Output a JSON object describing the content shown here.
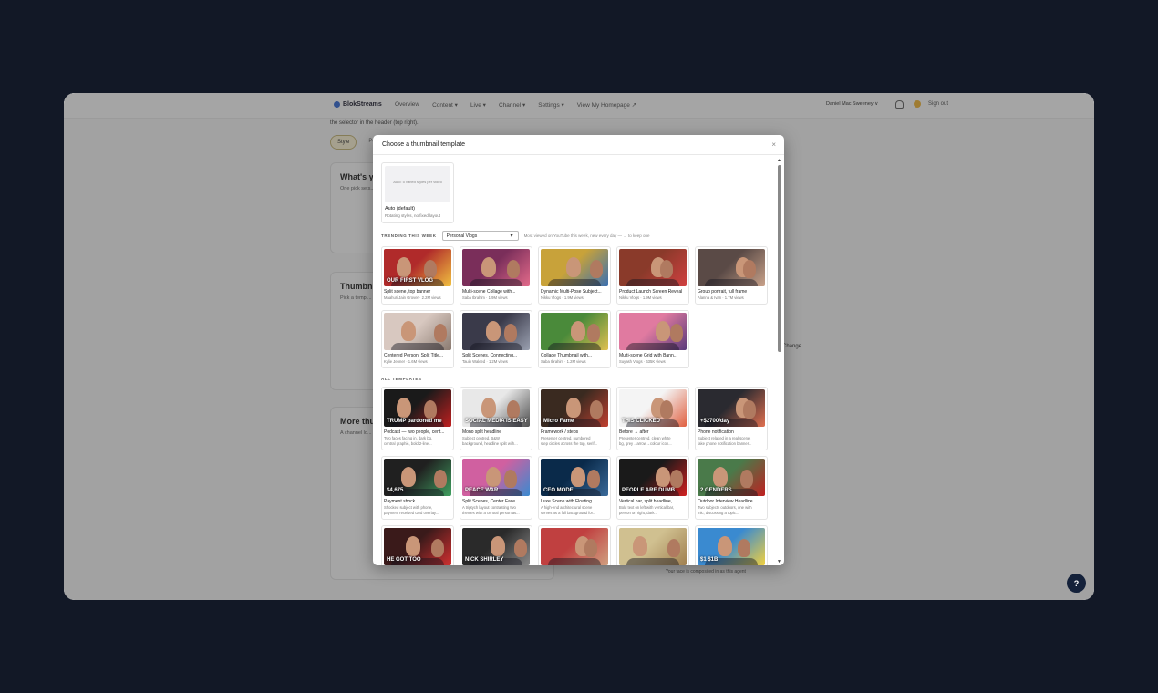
{
  "app": {
    "brand": "BlokStreams",
    "nav": [
      "Overview",
      "Content ▾",
      "Live ▾",
      "Channel ▾",
      "Settings ▾",
      "View My Homepage ↗"
    ],
    "user": "Daniel Mac Sweeney ∨",
    "signout": "Sign out",
    "hint": "the selector in the header (top right).",
    "pills": [
      "Style",
      "Pe"
    ],
    "cards": [
      {
        "title": "What's y",
        "text": "One pick sets... choose one), ... with the latte... override."
      },
      {
        "title": "Thumbn",
        "text": "Pick a templ... library phot... upload your ... most-viewe..."
      },
      {
        "title": "More thu",
        "text": "A channel lo... direction the..."
      }
    ],
    "change": "Change",
    "face_note": "Your face is composited in as this agent",
    "help": "?"
  },
  "modal": {
    "title": "Choose a thumbnail template",
    "close": "×",
    "auto": {
      "thumb_text": "Auto: 5 varied styles per video",
      "title": "Auto (default)",
      "sub": "Rotating styles, no fixed layout"
    },
    "trending_label": "TRENDING THIS WEEK",
    "trending_select": "Personal Vlogs",
    "trending_note": "Most viewed on YouTube this week, new every day — → to keep one",
    "trending": [
      {
        "title": "Split scene, top banner",
        "sub": "Maahuri Jain Grover · 2.2M views",
        "c1": "#b02a2a",
        "c2": "#f0c040",
        "text": "OUR FIRST VLOG"
      },
      {
        "title": "Multi-scene Collage with...",
        "sub": "Saba Ibrahim · 1.9M views",
        "c1": "#7a2e5a",
        "c2": "#e26a8a",
        "text": ""
      },
      {
        "title": "Dynamic Multi-Pose Subject...",
        "sub": "Nikku Vlogs · 1.9M views",
        "c1": "#c8a23a",
        "c2": "#3a6fb0",
        "text": ""
      },
      {
        "title": "Product Launch Screen Reveal",
        "sub": "Nikku Vlogs · 1.9M views",
        "c1": "#8a3a2a",
        "c2": "#d04040",
        "text": ""
      },
      {
        "title": "Group portrait, full frame",
        "sub": "Alanna & Ivan · 1.7M views",
        "c1": "#5a4a46",
        "c2": "#c9a28a",
        "text": ""
      },
      {
        "title": "Centered Person, Split Title...",
        "sub": "Kylie Jenner · 1.6M views",
        "c1": "#d8c8c0",
        "c2": "#8a7a70",
        "text": ""
      },
      {
        "title": "Split Scenes, Connecting...",
        "sub": "Tauib Waleed · 1.2M views",
        "c1": "#3a3a4a",
        "c2": "#9aa0b0",
        "text": ""
      },
      {
        "title": "Collage Thumbnail with...",
        "sub": "Saba Ibrahim · 1.2M views",
        "c1": "#4a8a3a",
        "c2": "#e0c050",
        "text": ""
      },
      {
        "title": "Multi-scene Grid with Bann...",
        "sub": "Suyash Vlogs · 635K views",
        "c1": "#e07aa0",
        "c2": "#5a3a7a",
        "text": ""
      }
    ],
    "all_label": "ALL TEMPLATES",
    "templates": [
      {
        "title": "Podcast — two people, cent...",
        "sub1": "Two faces facing in, dark bg,",
        "sub2": "central graphic, bold 2-line...",
        "c1": "#1a1a1a",
        "c2": "#c02020",
        "text": "TRUMP pardoned me"
      },
      {
        "title": "Mono split headline",
        "sub1": "Subject centred, B&W",
        "sub2": "background, headline split with...",
        "c1": "#e8e8e8",
        "c2": "#505050",
        "text": "SOCIAL MEDIA IS EASY"
      },
      {
        "title": "Framework / steps",
        "sub1": "Presenter centred, numbered",
        "sub2": "step circles across the top, serif...",
        "c1": "#3a2a20",
        "c2": "#c04030",
        "text": "Micro Fame"
      },
      {
        "title": "Before → after",
        "sub1": "Presenter centred, clean white",
        "sub2": "bg, grey→arrow→colour icon...",
        "c1": "#f4f4f4",
        "c2": "#e06040",
        "text": "THIS CLICKED"
      },
      {
        "title": "Phone notification",
        "sub1": "Subject relaxed in a real scene,",
        "sub2": "fake phone notification banner...",
        "c1": "#2a2a30",
        "c2": "#e07050",
        "text": "+$2700/day"
      },
      {
        "title": "Payment shock",
        "sub1": "Shocked subject with phone,",
        "sub2": "payment received card overlay...",
        "c1": "#202020",
        "c2": "#40a060",
        "text": "$4,675"
      },
      {
        "title": "Split Scenes, Center Face...",
        "sub1": "A triptych layout contrasting two",
        "sub2": "themes with a central person as...",
        "c1": "#d060a0",
        "c2": "#3a8ad0",
        "text": "PEACE  WAR"
      },
      {
        "title": "Luxe Scene with Floating...",
        "sub1": "A high-end architectural scene",
        "sub2": "serves as a full background for...",
        "c1": "#0a2a4a",
        "c2": "#3a6a9a",
        "text": "CEO MODE"
      },
      {
        "title": "Vertical bar, split headline,...",
        "sub1": "Bold text on left with vertical bar,",
        "sub2": "person on right, dark...",
        "c1": "#1a1a1a",
        "c2": "#d02020",
        "text": "PEOPLE ARE DUMB"
      },
      {
        "title": "Outdoor Interview Headline",
        "sub1": "Two subjects outdoors, one with",
        "sub2": "mic, discussing a topic...",
        "c1": "#4a7a4a",
        "c2": "#c02020",
        "text": "2 GENDERS"
      },
      {
        "title": "",
        "sub1": "",
        "sub2": "",
        "c1": "#3a1a1a",
        "c2": "#d03030",
        "text": "HE GOT TOO"
      },
      {
        "title": "",
        "sub1": "",
        "sub2": "",
        "c1": "#2a2a2a",
        "c2": "#8a8a8a",
        "text": "NICK SHIRLEY"
      },
      {
        "title": "",
        "sub1": "",
        "sub2": "",
        "c1": "#c04040",
        "c2": "#d0a080",
        "text": ""
      },
      {
        "title": "",
        "sub1": "",
        "sub2": "",
        "c1": "#d0c090",
        "c2": "#a08050",
        "text": ""
      },
      {
        "title": "",
        "sub1": "",
        "sub2": "",
        "c1": "#3a8ad0",
        "c2": "#f0d040",
        "text": "$1       $1B"
      }
    ]
  }
}
